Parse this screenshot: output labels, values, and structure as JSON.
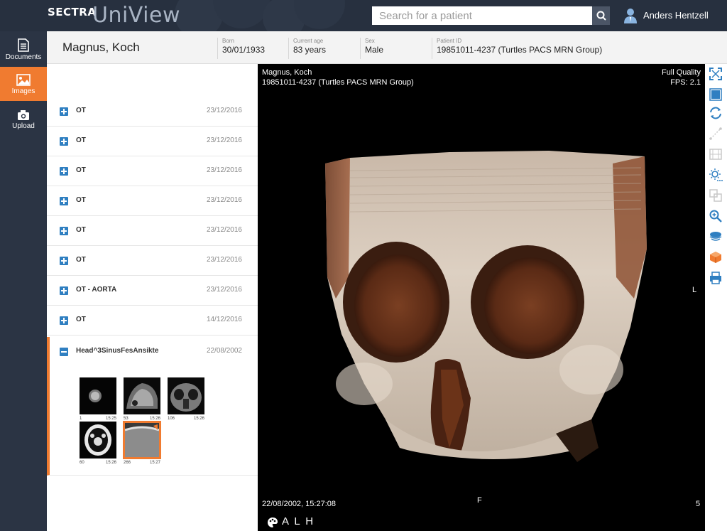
{
  "app": {
    "logo_brand": "SECTRA",
    "logo_product": "UniView"
  },
  "search": {
    "placeholder": "Search for a patient"
  },
  "user": {
    "name": "Anders Hentzell"
  },
  "nav": [
    {
      "label": "Documents",
      "icon": "document-icon"
    },
    {
      "label": "Images",
      "icon": "image-icon",
      "active": true
    },
    {
      "label": "Upload",
      "icon": "camera-icon"
    }
  ],
  "patient": {
    "name": "Magnus, Koch",
    "fields": [
      {
        "label": "Born",
        "value": "30/01/1933"
      },
      {
        "label": "Current age",
        "value": "83 years"
      },
      {
        "label": "Sex",
        "value": "Male"
      },
      {
        "label": "Patient ID",
        "value": "19851011-4237 (Turtles PACS MRN Group)"
      }
    ]
  },
  "series": [
    {
      "name": "OT",
      "date": "23/12/2016"
    },
    {
      "name": "OT",
      "date": "23/12/2016"
    },
    {
      "name": "OT",
      "date": "23/12/2016"
    },
    {
      "name": "OT",
      "date": "23/12/2016"
    },
    {
      "name": "OT",
      "date": "23/12/2016"
    },
    {
      "name": "OT",
      "date": "23/12/2016"
    },
    {
      "name": "OT - AORTA",
      "date": "23/12/2016"
    },
    {
      "name": "OT",
      "date": "14/12/2016"
    }
  ],
  "open_series": {
    "name": "Head^3SinusFesAnsikte",
    "date": "22/08/2002",
    "thumbnails": [
      {
        "num": "1",
        "time": "15:25"
      },
      {
        "num": "53",
        "time": "15:26"
      },
      {
        "num": "106",
        "time": "15:26"
      },
      {
        "num": "60",
        "time": "15:26"
      },
      {
        "num": "266",
        "time": "15:27",
        "selected": true
      }
    ]
  },
  "viewer": {
    "patient_name": "Magnus, Koch",
    "patient_id": "19851011-4237 (Turtles PACS MRN Group)",
    "quality": "Full Quality",
    "fps": "FPS: 2.1",
    "orient_right": "L",
    "orient_bottom": "F",
    "datetime": "22/08/2002, 15:27:08",
    "image_num": "5",
    "orient_cube": "A L H"
  },
  "toolbar": [
    "fit-screen-icon",
    "layout-icon",
    "rotate-icon",
    "measure-icon",
    "film-icon",
    "brightness-icon",
    "compare-icon",
    "zoom-icon",
    "windowing-icon",
    "3d-cube-icon",
    "print-icon"
  ],
  "colors": {
    "accent": "#f07b30",
    "tool_blue": "#2f7fc1",
    "topbar": "#27303f"
  }
}
